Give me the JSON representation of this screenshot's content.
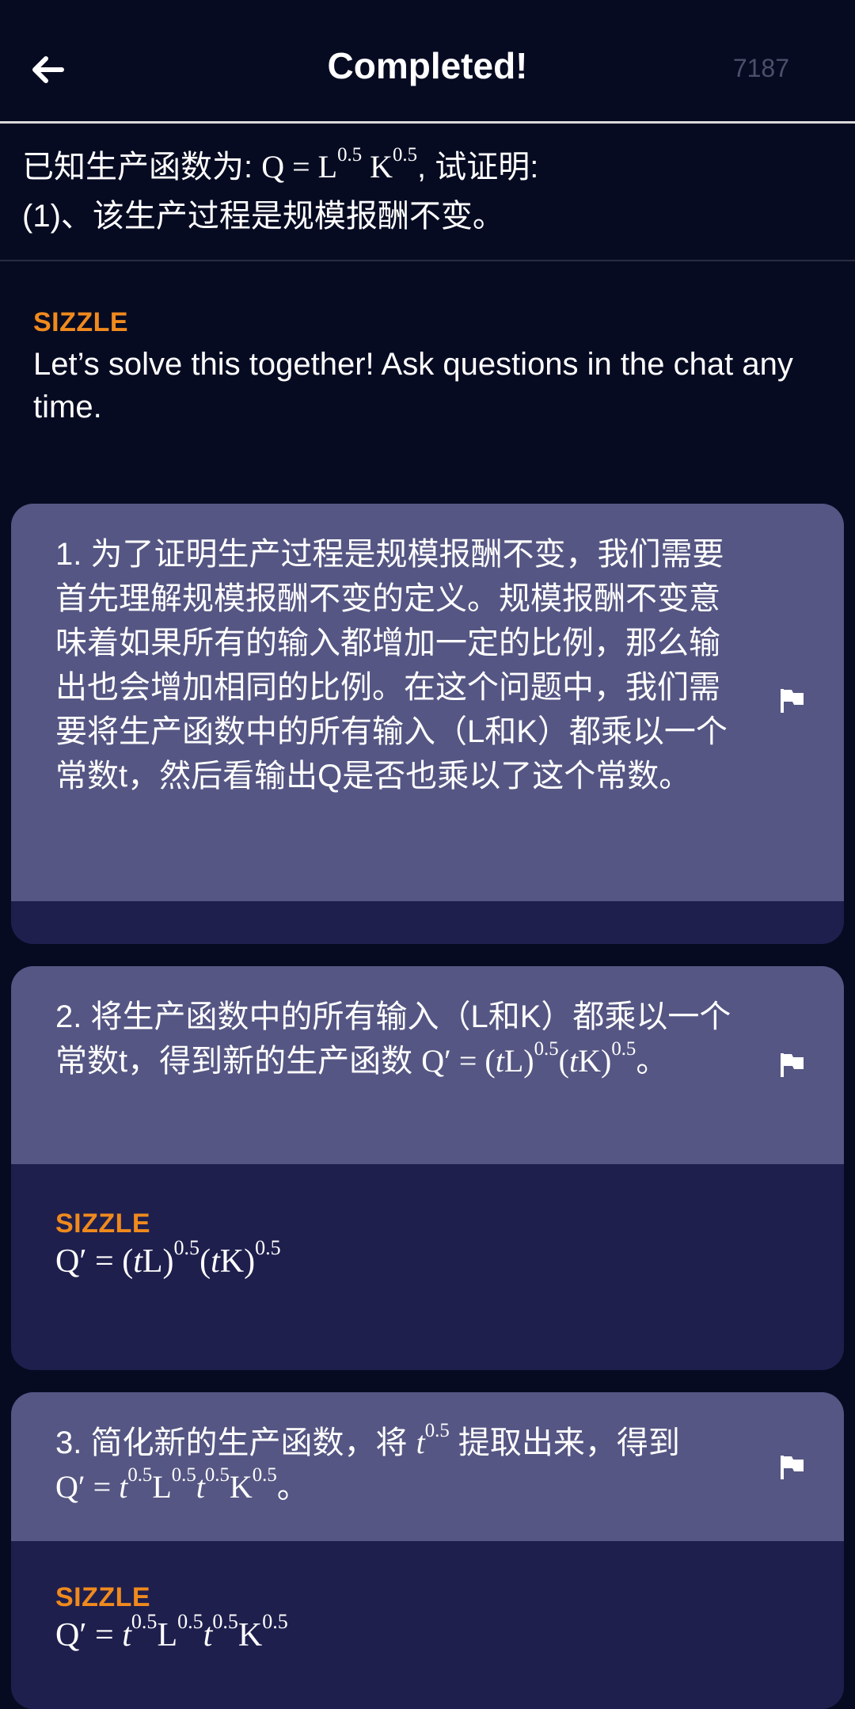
{
  "header": {
    "title": "Completed!",
    "id": "7187"
  },
  "problem": {
    "prefix": "已知生产函数为: ",
    "suffix": ", 试证明:",
    "line2": "(1)、该生产过程是规模报酬不变。"
  },
  "intro": {
    "label": "SIZZLE",
    "text": "Let’s solve this together! Ask questions in the chat any time."
  },
  "steps": [
    {
      "text": "1. 为了证明生产过程是规模报酬不变，我们需要首先理解规模报酬不变的定义。规模报酬不变意味着如果所有的输入都增加一定的比例，那么输出也会增加相同的比例。在这个问题中，我们需要将生产函数中的所有输入（L和K）都乘以一个常数t，然后看输出Q是否也乘以了这个常数。"
    },
    {
      "text_prefix": "2. 将生产函数中的所有输入（L和K）都乘以一个常数t，得到新的生产函数 ",
      "reply_label": "SIZZLE"
    },
    {
      "text_prefix": "3. 简化新的生产函数，将 ",
      "text_mid": " 提取出来，得到",
      "reply_label": "SIZZLE"
    }
  ],
  "icons": {
    "back": "arrow-left-icon",
    "flag": "flag-icon"
  },
  "colors": {
    "background": "#070b22",
    "card_top": "#555683",
    "card_bottom": "#1f1f4e",
    "accent": "#f08a1d"
  }
}
